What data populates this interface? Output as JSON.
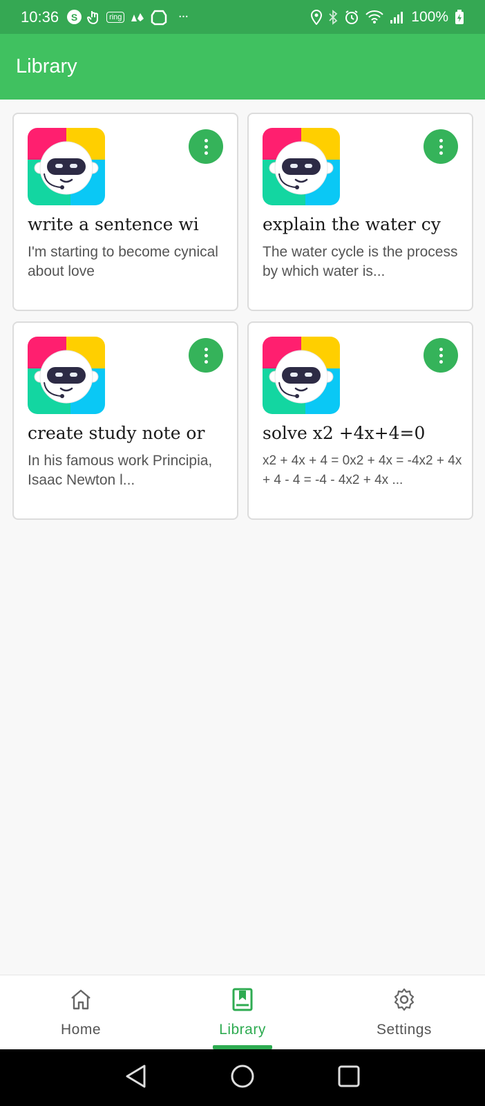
{
  "status_bar": {
    "time": "10:36",
    "s_badge": "S",
    "ring_badge": "ring",
    "more": "•••",
    "battery": "100%"
  },
  "app_bar": {
    "title": "Library"
  },
  "cards": [
    {
      "title": "write a sentence wi",
      "text": "I'm starting to become cynical about love"
    },
    {
      "title": "explain the water cy",
      "text": "The water cycle is the process by which water is..."
    },
    {
      "title": "create study note or",
      "text": "In his famous work Principia, Isaac Newton l..."
    },
    {
      "title": "solve x2 +4x+4=0",
      "text": "x2 + 4x + 4 = 0x2 + 4x = -4x2 + 4x + 4 - 4 = -4 - 4x2 + 4x ..."
    }
  ],
  "bottom_nav": [
    {
      "label": "Home",
      "icon": "home-icon"
    },
    {
      "label": "Library",
      "icon": "book-icon",
      "active": true
    },
    {
      "label": "Settings",
      "icon": "gear-icon"
    }
  ],
  "colors": {
    "status_bar": "#35a853",
    "app_bar": "#40c160",
    "accent": "#2eab51",
    "menu_button": "#35b35a"
  }
}
